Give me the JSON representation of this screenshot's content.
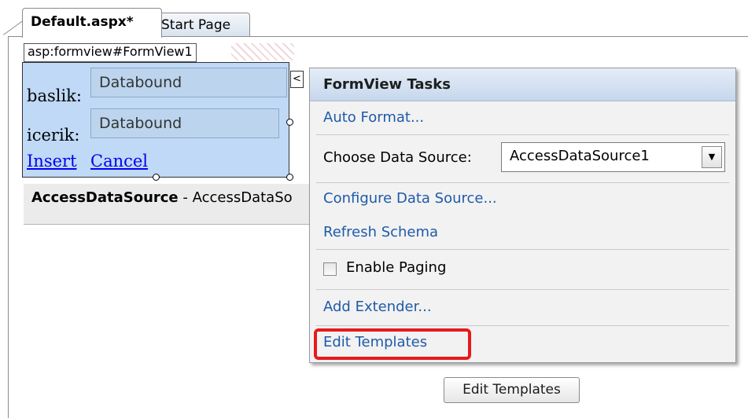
{
  "tabs": [
    {
      "label": "Default.aspx*",
      "active": true
    },
    {
      "label": "Start Page",
      "active": false
    }
  ],
  "designer": {
    "control_tag": "asp:formview#FormView1",
    "formview": {
      "field1_label": "baslik:",
      "field1_value": "Databound",
      "field2_label": "icerik:",
      "field2_value": "Databound",
      "insert_link": "Insert",
      "cancel_link": "Cancel"
    },
    "smart_tag_glyph": "<",
    "datasource_strip": {
      "bold": "AccessDataSource",
      "rest": " - AccessDataSo"
    }
  },
  "tasks_panel": {
    "title": "FormView Tasks",
    "auto_format": "Auto Format...",
    "choose_label": "Choose Data Source:",
    "choose_value": "AccessDataSource1",
    "configure": "Configure Data Source...",
    "refresh": "Refresh Schema",
    "enable_paging": "Enable Paging",
    "add_extender": "Add Extender...",
    "edit_templates": "Edit Templates"
  },
  "tooltip": "Edit Templates",
  "colors": {
    "highlight": "#e8191c",
    "link": "#1f5aa8",
    "formview_bg": "#bfd9f7"
  },
  "icons": {
    "dropdown": "chevron-down-icon",
    "smart_tag": "chevron-left-icon"
  }
}
